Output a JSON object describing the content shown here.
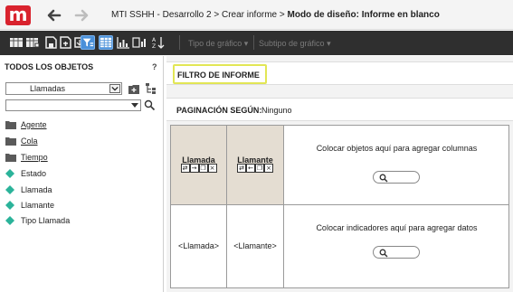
{
  "header": {
    "logo_text": "m",
    "breadcrumb_part1": "MTI SSHH - Desarrollo 2 > Crear informe > ",
    "breadcrumb_current": "Modo de diseño: Informe en blanco"
  },
  "toolbar": {
    "chart_type": "Tipo de gráfico",
    "chart_subtype": "Subtipo de gráfico"
  },
  "left_panel": {
    "title": "TODOS LOS OBJETOS",
    "help": "?",
    "selected_object": "Llamadas",
    "search_value": "",
    "items": [
      {
        "label": "Agente",
        "icon": "folder-icon",
        "link": true
      },
      {
        "label": "Cola",
        "icon": "folder-icon",
        "link": true
      },
      {
        "label": "Tiempo",
        "icon": "folder-icon",
        "link": true
      },
      {
        "label": "Estado",
        "icon": "diamond-icon",
        "link": false
      },
      {
        "label": "Llamada",
        "icon": "diamond-icon",
        "link": false
      },
      {
        "label": "Llamante",
        "icon": "diamond-icon",
        "link": false
      },
      {
        "label": "Tipo Llamada",
        "icon": "diamond-icon",
        "link": false
      }
    ]
  },
  "main": {
    "filter_label": "FILTRO DE INFORME",
    "pagination_label": "PAGINACIÓN SEGÚN:",
    "pagination_value": "Ninguno",
    "columns": [
      {
        "title": "Llamada",
        "row_value": "<Llamada>"
      },
      {
        "title": "Llamante",
        "row_value": "<Llamante>"
      }
    ],
    "drop_columns_text": "Colocar objetos aquí para agregar columnas",
    "drop_indicators_text": "Colocar indicadores aquí para agregar datos"
  },
  "colors": {
    "brand": "#d9232e",
    "toolbar_bg": "#2f2f2f",
    "active_tool": "#4a90d9",
    "highlight_border": "#e2e655",
    "column_header_bg": "#e4ddd2",
    "dimension_icon": "#2bb39a",
    "folder_icon": "#5a5a5a"
  }
}
